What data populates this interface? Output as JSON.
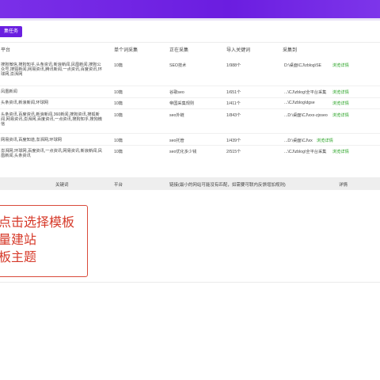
{
  "toolbar": {
    "task_button": "集任务"
  },
  "table": {
    "headers": [
      "平台",
      "单个词采集",
      "正在采集",
      "导入关键词",
      "采集到"
    ],
    "rows": [
      {
        "platform": "搜狗微信,搜狗知乎,头条资讯,新浪新闻,凤凰新闻,搜狗公众号,搜狐新闻,网易资讯,腾讯新闻,一点资讯,百度资讯,环球网,澎湃网",
        "single": "10篇",
        "current": "SEO技术",
        "imported": "1/988个",
        "target": "D:\\桌面\\CJ\\zblog\\SE",
        "link": "浏览详情"
      },
      {
        "platform": "凤凰新闻",
        "single": "10篇",
        "current": "谷歌seo",
        "imported": "1/651个",
        "target": "...\\CJ\\zblog\\全平台采集",
        "link": "浏览详情"
      },
      {
        "platform": "头条资讯,新浪新闻,环球网",
        "single": "10篇",
        "current": "帝国采集规则",
        "imported": "1/411个",
        "target": "...\\CJ\\zblog\\dgse",
        "link": "浏览详情"
      },
      {
        "platform": "头条资讯,百度资讯,新浪新闻,360新闻,搜狗资讯,搜狐新闻,网易资讯,澎湃网,百度资讯,一点资讯,搜狗知乎,搜狗微信",
        "single": "10篇",
        "current": "seo外链",
        "imported": "1/843个",
        "target": "...D:\\桌面\\CJ\\xxx-zjxseo",
        "link": "浏览详情"
      },
      {
        "platform": "网易资讯,百度知道,澎湃网,环球网",
        "single": "10篇",
        "current": "seo托管",
        "imported": "1/439个",
        "target": "...D:\\桌面\\CJ\\xx",
        "link": "浏览详情"
      },
      {
        "platform": "澎湃网,环球网,百度资讯,一点资讯,网易资讯,新浪新闻,凤凰新闻,头条资讯",
        "single": "10篇",
        "current": "seo优化多少钱",
        "imported": "2/515个",
        "target": "...\\CJ\\zblog\\全平台采集",
        "link": "浏览详情"
      }
    ]
  },
  "table2": {
    "headers": [
      "关键词",
      "平台",
      "链接(最小的网站可能没有匹配，如需要可联内反馈增加规则)",
      "详情"
    ]
  },
  "annotation": {
    "lines": [
      "点击选择模板",
      "量建站",
      "板主题"
    ],
    "color": "#d63a2a"
  },
  "colors": {
    "accent": "#6a1fe0",
    "link": "#22a01e"
  }
}
